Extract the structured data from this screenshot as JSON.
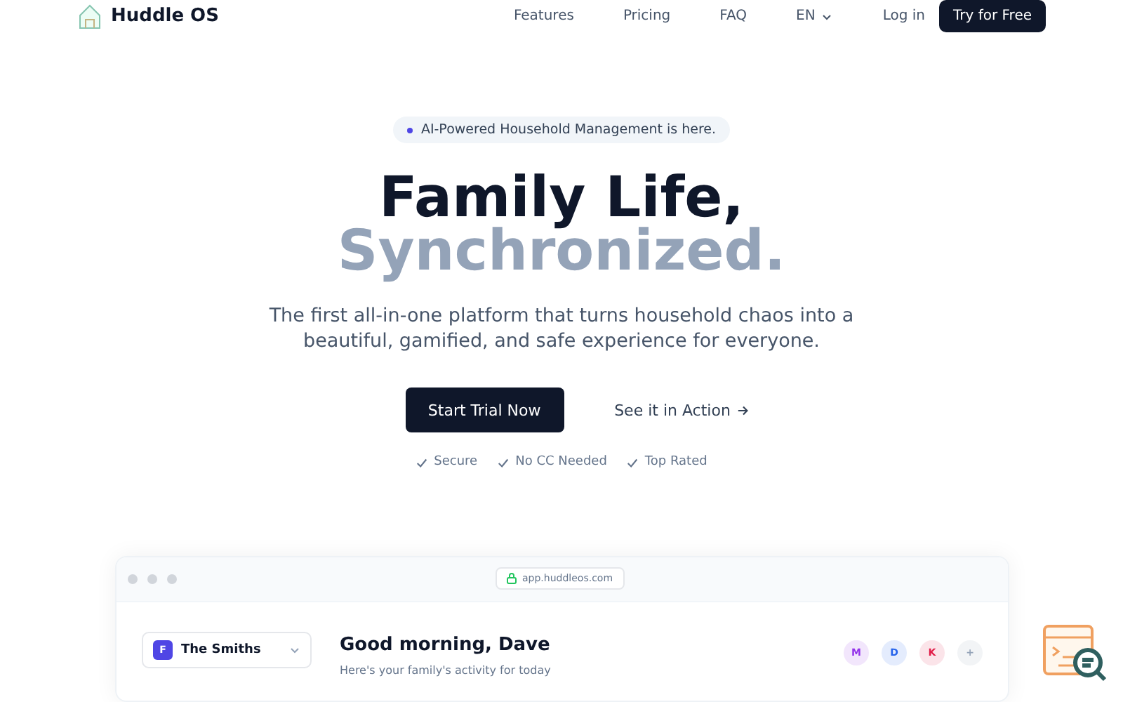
{
  "nav": {
    "brand": "Huddle OS",
    "links": [
      "Features",
      "Pricing",
      "FAQ"
    ],
    "language": "EN",
    "login": "Log in",
    "cta": "Try for Free"
  },
  "hero": {
    "badge": "AI-Powered Household Management is here.",
    "title_line1": "Family Life,",
    "title_line2": "Synchronized.",
    "subtitle": "The first all-in-one platform that turns household chaos into a beautiful, gamified, and safe experience for everyone.",
    "primary_button": "Start Trial Now",
    "secondary_button": "See it in Action",
    "features": [
      "Secure",
      "No CC Needed",
      "Top Rated"
    ]
  },
  "preview": {
    "url": "app.huddleos.com",
    "family": {
      "initial": "F",
      "name": "The Smiths"
    },
    "greeting": "Good morning, Dave",
    "subgreeting": "Here's your family's activity for today",
    "members": [
      {
        "initial": "M",
        "color": "#9333ea"
      },
      {
        "initial": "D",
        "color": "#2563eb"
      },
      {
        "initial": "K",
        "color": "#e11d48"
      }
    ],
    "add": "+"
  }
}
